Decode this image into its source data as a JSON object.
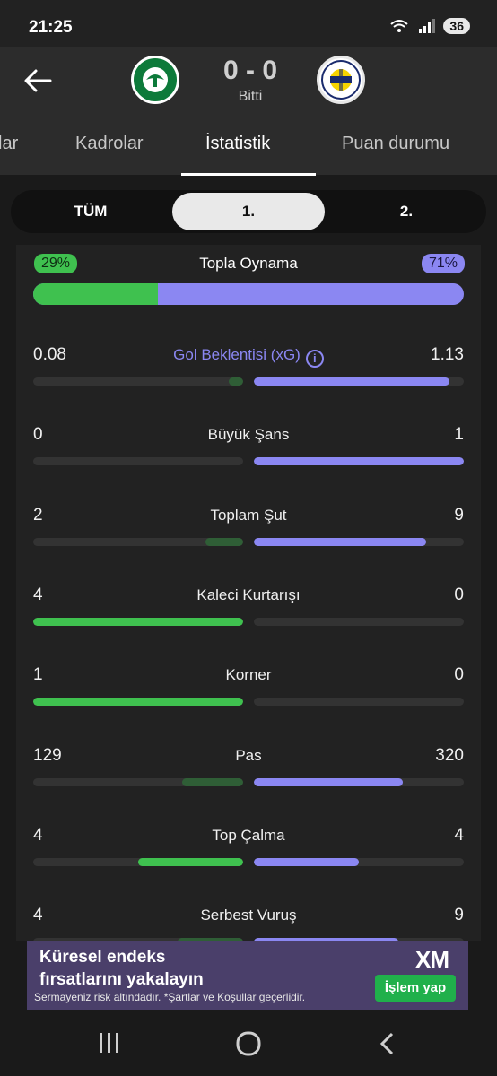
{
  "status_bar": {
    "time": "21:25",
    "battery": "36"
  },
  "match": {
    "score": "0 - 0",
    "status": "Bitti",
    "home_crest": "konyaspor-crest",
    "away_crest": "fenerbahce-crest"
  },
  "tabs": [
    {
      "label": "lar"
    },
    {
      "label": "Kadrolar"
    },
    {
      "label": "İstatistik"
    },
    {
      "label": "Puan durumu"
    }
  ],
  "periods": [
    {
      "label": "TÜM"
    },
    {
      "label": "1."
    },
    {
      "label": "2."
    }
  ],
  "selected_period": "1.",
  "possession": {
    "label": "Topla Oynama",
    "home": "29%",
    "away": "71%",
    "home_value": 29,
    "away_value": 71
  },
  "stats": [
    {
      "label": "Gol Beklentisi (xG)",
      "home": "0.08",
      "away": "1.13",
      "home_fill": 0.07,
      "away_fill": 0.93,
      "leader": "away",
      "has_info": true
    },
    {
      "label": "Büyük Şans",
      "home": "0",
      "away": "1",
      "home_fill": 0,
      "away_fill": 1.0,
      "leader": "away"
    },
    {
      "label": "Toplam Şut",
      "home": "2",
      "away": "9",
      "home_fill": 0.18,
      "away_fill": 0.82,
      "leader": "away"
    },
    {
      "label": "Kaleci Kurtarışı",
      "home": "4",
      "away": "0",
      "home_fill": 1.0,
      "away_fill": 0,
      "leader": "home"
    },
    {
      "label": "Korner",
      "home": "1",
      "away": "0",
      "home_fill": 1.0,
      "away_fill": 0,
      "leader": "home"
    },
    {
      "label": "Pas",
      "home": "129",
      "away": "320",
      "home_fill": 0.29,
      "away_fill": 0.71,
      "leader": "away"
    },
    {
      "label": "Top Çalma",
      "home": "4",
      "away": "4",
      "home_fill": 0.5,
      "away_fill": 0.5,
      "leader": "both"
    },
    {
      "label": "Serbest Vuruş",
      "home": "4",
      "away": "9",
      "home_fill": 0.31,
      "away_fill": 0.69,
      "leader": "away"
    }
  ],
  "ad": {
    "headline_1": "Küresel endeks",
    "headline_2": "fırsatlarını yakalayın",
    "disclaimer": "Sermayeniz risk altındadır. *Şartlar ve Koşullar geçerlidir.",
    "brand": "XM",
    "cta": "İşlem yap"
  },
  "colors": {
    "home": "#3fc14f",
    "away": "#8b87f2",
    "home_dim": "#2f5e36"
  }
}
